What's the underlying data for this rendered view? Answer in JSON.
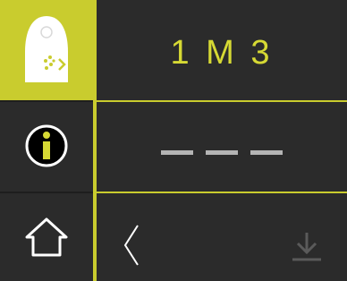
{
  "device": {
    "accent_color": "#c9cc2e",
    "background_color": "#2b2b2b"
  },
  "sidebar": {
    "items": [
      {
        "icon": "sensor-shield-icon",
        "active": true
      },
      {
        "icon": "info-icon",
        "active": false
      },
      {
        "icon": "home-icon",
        "active": false
      }
    ]
  },
  "main": {
    "code": "1 M 3",
    "value": "— — —"
  },
  "footer": {
    "back_icon": "chevron-left-icon",
    "save_icon": "download-icon"
  }
}
